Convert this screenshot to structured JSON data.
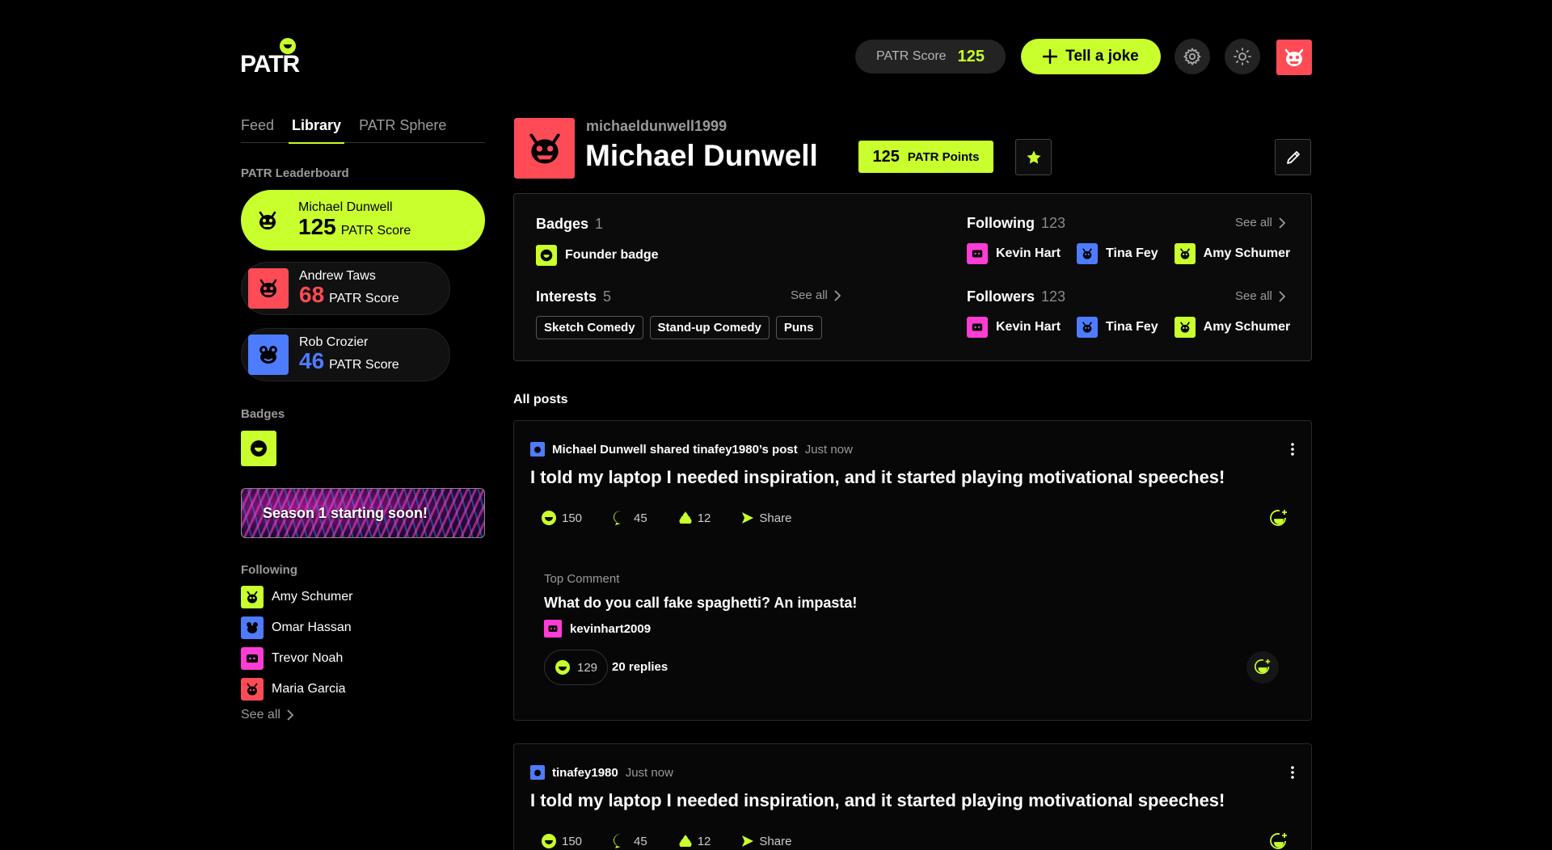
{
  "colors": {
    "accent": "#c8ff2d",
    "red": "#ff4b55",
    "blue": "#4d7cff",
    "pink": "#ff3dd4",
    "bg": "#000000"
  },
  "header": {
    "logo_text": "PATR",
    "score_label": "PATR Score",
    "score_value": "125",
    "joke_button": "Tell a joke",
    "settings_icon": "gear-icon",
    "theme_icon": "sun-icon",
    "profile_icon": "monster-avatar-icon"
  },
  "tabs": [
    {
      "label": "Feed",
      "active": false
    },
    {
      "label": "Library",
      "active": true
    },
    {
      "label": "PATR Sphere",
      "active": false
    }
  ],
  "sidebar": {
    "leaderboard_title": "PATR Leaderboard",
    "leaderboard": [
      {
        "name": "Michael Dunwell",
        "score": "125",
        "score_label": "PATR Score",
        "color": "#c8ff2d"
      },
      {
        "name": "Andrew Taws",
        "score": "68",
        "score_label": "PATR Score",
        "color": "#ff4b55"
      },
      {
        "name": "Rob Crozier",
        "score": "46",
        "score_label": "PATR Score",
        "color": "#4d7cff"
      }
    ],
    "badges_title": "Badges",
    "season_banner": "Season 1 starting soon!",
    "following_title": "Following",
    "following": [
      {
        "name": "Amy Schumer",
        "color": "#c8ff2d"
      },
      {
        "name": "Omar Hassan",
        "color": "#4d7cff"
      },
      {
        "name": "Trevor Noah",
        "color": "#ff3dd4"
      },
      {
        "name": "Maria Garcia",
        "color": "#ff4b55"
      }
    ],
    "see_all": "See all"
  },
  "profile": {
    "handle": "michaeldunwell1999",
    "name": "Michael Dunwell",
    "points": "125",
    "points_label": "PATR Points",
    "badges_title": "Badges",
    "badges_count": "1",
    "badge_name": "Founder badge",
    "interests_title": "Interests",
    "interests_count": "5",
    "interests": [
      "Sketch Comedy",
      "Stand-up Comedy",
      "Puns"
    ],
    "following_title": "Following",
    "following_count": "123",
    "followers_title": "Followers",
    "followers_count": "123",
    "see_all": "See all",
    "people": [
      {
        "name": "Kevin Hart",
        "color": "#ff3dd4"
      },
      {
        "name": "Tina Fey",
        "color": "#4d7cff"
      },
      {
        "name": "Amy Schumer",
        "color": "#c8ff2d"
      }
    ]
  },
  "posts_title": "All posts",
  "posts": [
    {
      "who": "Michael Dunwell shared tinafey1980’s post",
      "time": "Just now",
      "text": "I told my laptop I needed inspiration, and it started playing motivational speeches!",
      "laughs": "150",
      "comments": "45",
      "poops": "12",
      "share": "Share",
      "top_comment_label": "Top Comment",
      "top_comment": "What do you call fake spaghetti? An impasta!",
      "commenter": "kevinhart2009",
      "comment_laughs": "129",
      "replies": "20 replies"
    },
    {
      "who": "tinafey1980",
      "time": "Just now",
      "text": "I told my laptop I needed inspiration, and it started playing motivational speeches!",
      "laughs": "150",
      "comments": "45",
      "poops": "12",
      "share": "Share"
    }
  ]
}
